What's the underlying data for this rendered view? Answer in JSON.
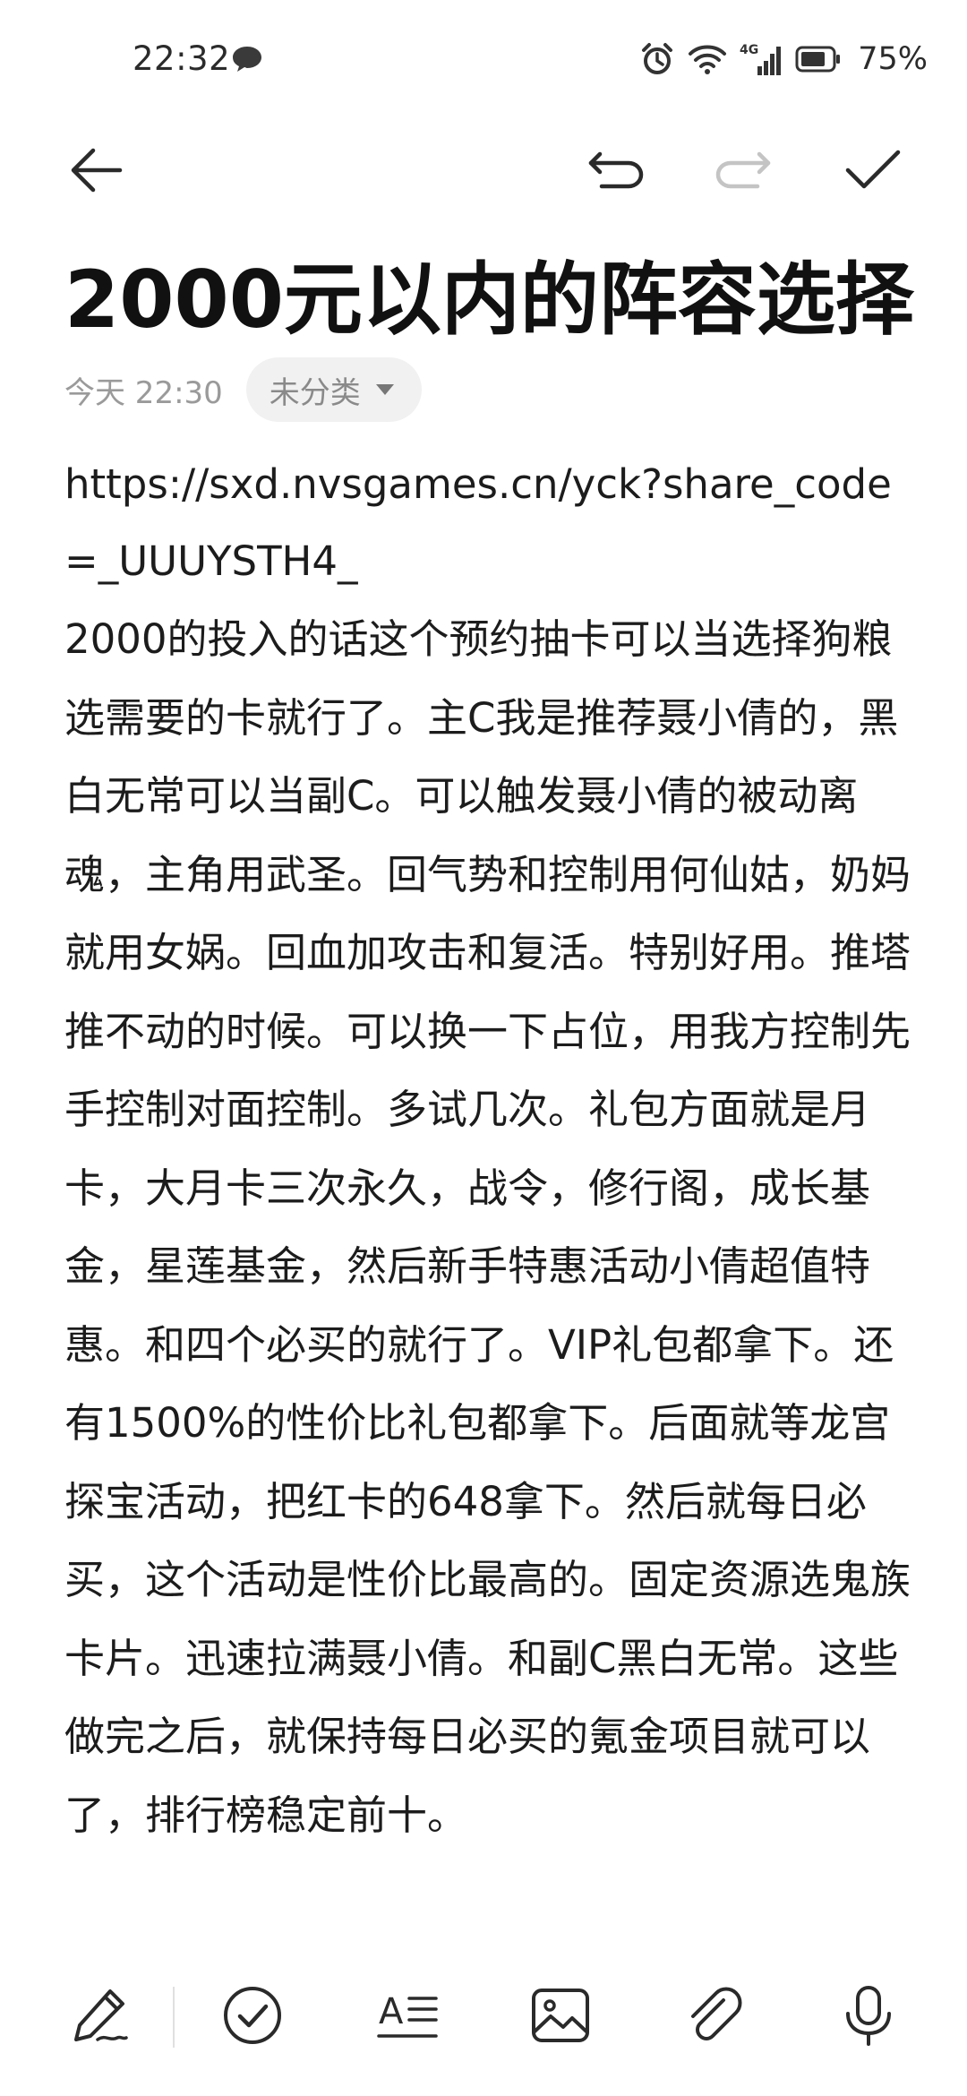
{
  "status_bar": {
    "time": "22:32",
    "signal_label": "4G",
    "battery": "75%"
  },
  "toolbar": {
    "back_icon": "arrow-left-icon",
    "undo_icon": "undo-icon",
    "redo_icon": "redo-icon",
    "done_icon": "checkmark-icon"
  },
  "note": {
    "title": "2000元以内的阵容选择",
    "time": "今天 22:30",
    "category": "未分类",
    "url": "https://sxd.nvsgames.cn/yck?share_code=_UUUYSTH4_",
    "body": "2000的投入的话这个预约抽卡可以当选择狗粮选需要的卡就行了。主C我是推荐聂小倩的，黑白无常可以当副C。可以触发聂小倩的被动离魂，主角用武圣。回气势和控制用何仙姑，奶妈就用女娲。回血加攻击和复活。特别好用。推塔推不动的时候。可以换一下占位，用我方控制先手控制对面控制。多试几次。礼包方面就是月卡，大月卡三次永久，战令，修行阁，成长基金，星莲基金，然后新手特惠活动小倩超值特惠。和四个必买的就行了。VIP礼包都拿下。还有1500%的性价比礼包都拿下。后面就等龙宫探宝活动，把红卡的648拿下。然后就每日必买，这个活动是性价比最高的。固定资源选鬼族卡片。迅速拉满聂小倩。和副C黑白无常。这些做完之后，就保持每日必买的氪金项目就可以了，排行榜稳定前十。"
  },
  "bottom_toolbar": {
    "items": [
      "pen-icon",
      "checklist-icon",
      "text-format-icon",
      "image-icon",
      "attachment-icon",
      "microphone-icon"
    ]
  },
  "colors": {
    "text": "#1c1c1c",
    "meta": "#9a9a9a",
    "chip_bg": "#f1f1f1",
    "disabled": "#c4c4c4"
  }
}
